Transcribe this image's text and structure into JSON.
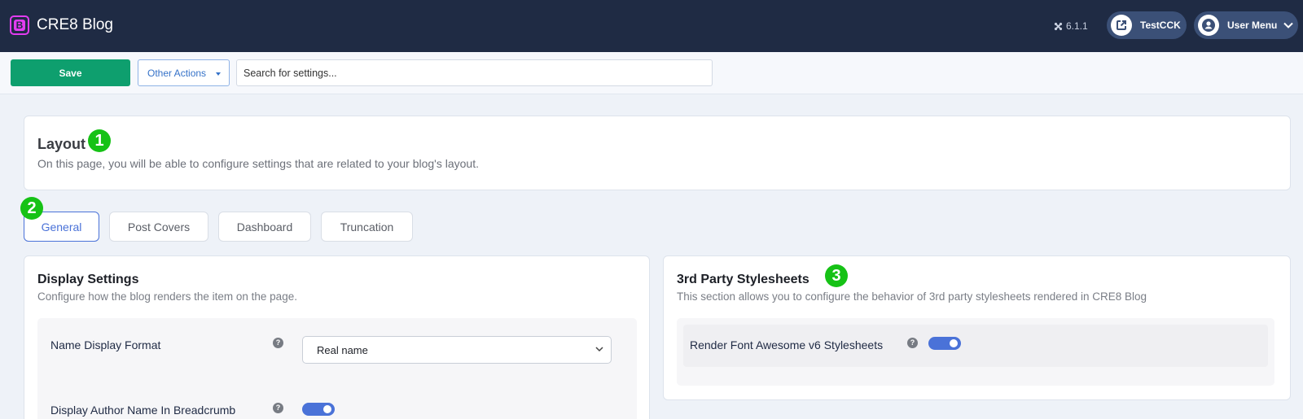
{
  "app": {
    "title": "CRE8 Blog",
    "logo_letter": "B",
    "version": "6.1.1"
  },
  "header": {
    "site_link_label": "TestCCK",
    "user_menu_label": "User Menu"
  },
  "toolbar": {
    "save_label": "Save",
    "other_actions_label": "Other Actions",
    "search_placeholder": "Search for settings..."
  },
  "page": {
    "title": "Layout",
    "description": "On this page, you will be able to configure settings that are related to your blog's layout."
  },
  "tabs": [
    {
      "label": "General",
      "active": true
    },
    {
      "label": "Post Covers",
      "active": false
    },
    {
      "label": "Dashboard",
      "active": false
    },
    {
      "label": "Truncation",
      "active": false
    }
  ],
  "display_settings": {
    "title": "Display Settings",
    "description": "Configure how the blog renders the item on the page.",
    "name_display_format": {
      "label": "Name Display Format",
      "value": "Real name"
    },
    "author_breadcrumb": {
      "label": "Display Author Name In Breadcrumb",
      "enabled": true
    }
  },
  "stylesheets": {
    "title": "3rd Party Stylesheets",
    "description": "This section allows you to configure the behavior of 3rd party stylesheets rendered in CRE8 Blog",
    "font_awesome": {
      "label": "Render Font Awesome v6 Stylesheets",
      "enabled": true
    }
  },
  "annotations": {
    "one": "1",
    "two": "2",
    "three": "3"
  },
  "help_glyph": "?",
  "colors": {
    "header_bg": "#1f2b44",
    "save_green": "#0e9f6e",
    "accent_blue": "#4a72d8",
    "annotation_green": "#16c216",
    "logo_magenta": "#e23cf0"
  }
}
